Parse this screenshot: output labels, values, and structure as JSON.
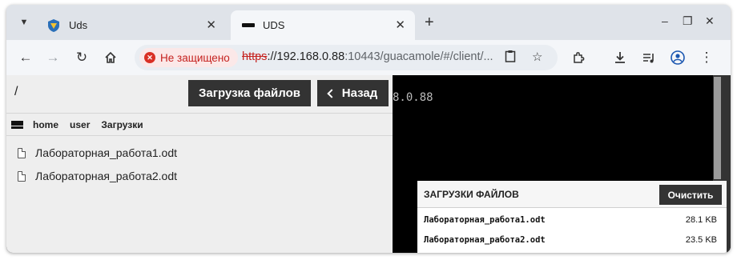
{
  "browser": {
    "tabs": [
      {
        "label": "Uds"
      },
      {
        "label": "UDS"
      }
    ],
    "security_chip": "Не защищено",
    "url_scheme": "https",
    "url_rest": "://192.168.0.88",
    "url_tail": ":10443/guacamole/#/client/..."
  },
  "file_manager": {
    "path": "/",
    "upload_button": "Загрузка файлов",
    "back_button": "Назад",
    "breadcrumb": [
      "home",
      "user",
      "Загрузки"
    ],
    "files": [
      "Лабораторная_работа1.odt",
      "Лабораторная_работа2.odt"
    ]
  },
  "terminal": {
    "text": "8.0.88"
  },
  "downloads": {
    "title": "ЗАГРУЗКИ ФАЙЛОВ",
    "clear_button": "Очистить",
    "items": [
      {
        "name": "Лабораторная_работа1.odt",
        "size": "28.1 KB"
      },
      {
        "name": "Лабораторная_работа2.odt",
        "size": "23.5 KB"
      }
    ]
  }
}
